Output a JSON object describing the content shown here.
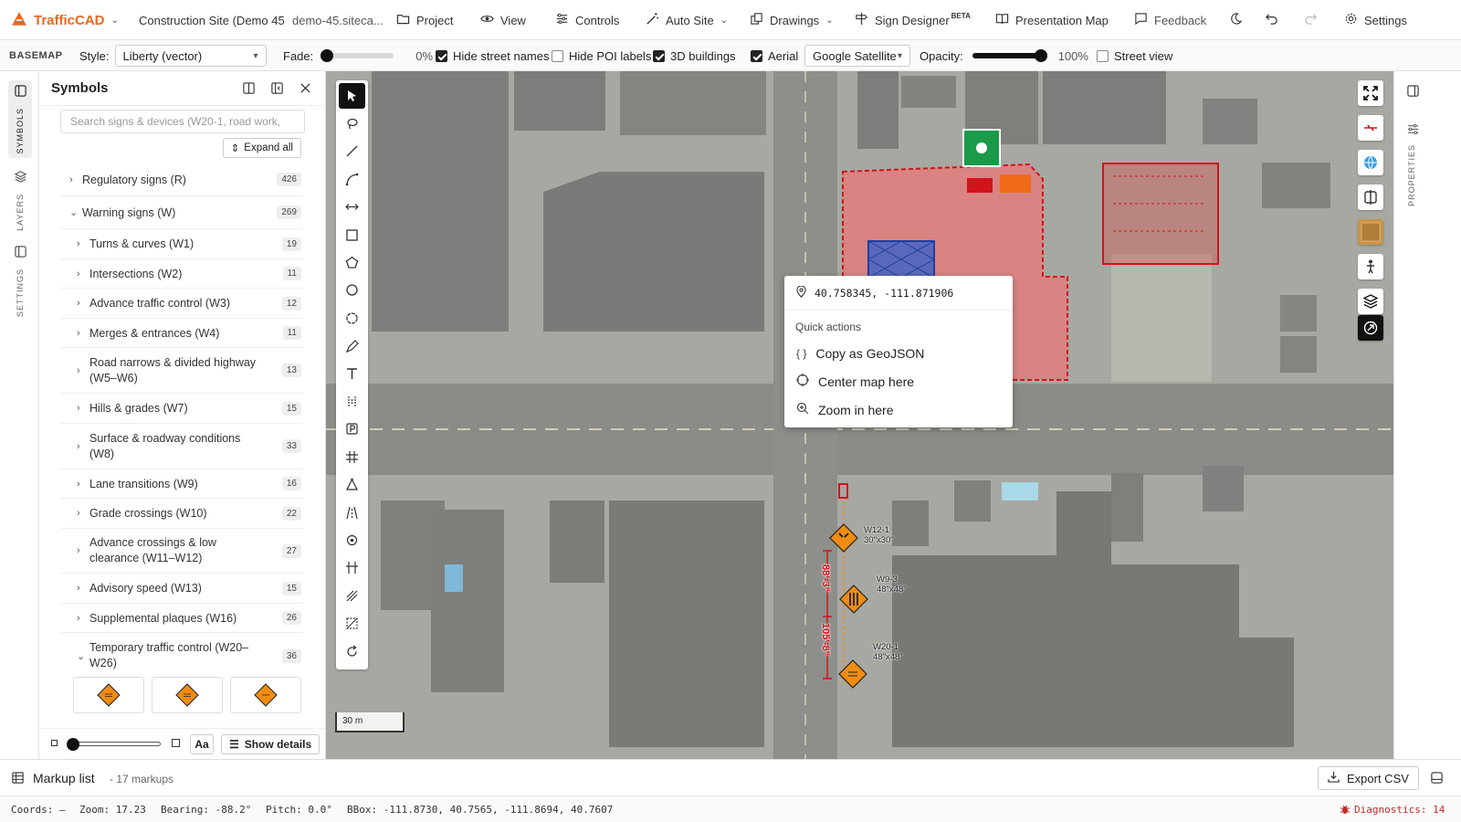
{
  "topbar": {
    "brand": "TrafficCAD",
    "project_name": "Construction Site (Demo 45",
    "project_url": "demo-45.siteca...",
    "project": "Project",
    "view": "View",
    "controls": "Controls",
    "auto_site": "Auto Site",
    "drawings": "Drawings",
    "sign_designer": "Sign Designer",
    "beta": "BETA",
    "presentation_map": "Presentation Map",
    "feedback": "Feedback",
    "settings": "Settings"
  },
  "basemap": {
    "section": "BASEMAP",
    "style_label": "Style:",
    "style_value": "Liberty (vector)",
    "fade_label": "Fade:",
    "fade_value": "0%",
    "fade_level": 0,
    "hide_street_names": "Hide street names",
    "hide_street_names_checked": true,
    "hide_poi_labels": "Hide POI labels",
    "hide_poi_labels_checked": false,
    "buildings_3d": "3D buildings",
    "buildings_3d_checked": true,
    "aerial": "Aerial",
    "aerial_checked": true,
    "aerial_source": "Google Satellite",
    "opacity_label": "Opacity:",
    "opacity_value": "100%",
    "opacity_level": 1,
    "street_view": "Street view",
    "street_view_checked": false
  },
  "rail": {
    "tabs": [
      "SYMBOLS",
      "LAYERS",
      "SETTINGS"
    ]
  },
  "symbols": {
    "title": "Symbols",
    "search_placeholder": "Search signs & devices (W20-1, road work,",
    "expand_all": "Expand all",
    "categories": [
      {
        "label": "Regulatory signs (R)",
        "count": "426",
        "expanded": false,
        "level": 0
      },
      {
        "label": "Warning signs (W)",
        "count": "269",
        "expanded": true,
        "level": 0
      },
      {
        "label": "Turns & curves (W1)",
        "count": "19",
        "level": 1
      },
      {
        "label": "Intersections (W2)",
        "count": "11",
        "level": 1
      },
      {
        "label": "Advance traffic control (W3)",
        "count": "12",
        "level": 1
      },
      {
        "label": "Merges & entrances (W4)",
        "count": "11",
        "level": 1
      },
      {
        "label": "Road narrows & divided highway (W5–W6)",
        "count": "13",
        "level": 1
      },
      {
        "label": "Hills & grades (W7)",
        "count": "15",
        "level": 1
      },
      {
        "label": "Surface & roadway conditions (W8)",
        "count": "33",
        "level": 1
      },
      {
        "label": "Lane transitions (W9)",
        "count": "16",
        "level": 1
      },
      {
        "label": "Grade crossings (W10)",
        "count": "22",
        "level": 1
      },
      {
        "label": "Advance crossings & low clearance (W11–W12)",
        "count": "27",
        "level": 1
      },
      {
        "label": "Advisory speed (W13)",
        "count": "15",
        "level": 1
      },
      {
        "label": "Supplemental plaques (W16)",
        "count": "26",
        "level": 1
      },
      {
        "label": "Temporary traffic control (W20–W26)",
        "count": "36",
        "expanded": true,
        "level": 1
      }
    ],
    "aa": "Aa",
    "show_details": "Show details"
  },
  "map": {
    "context_menu": {
      "coords": "40.758345, -111.871906",
      "heading": "Quick actions",
      "actions": [
        "Copy as GeoJSON",
        "Center map here",
        "Zoom in here"
      ]
    },
    "scale": "30 m",
    "signs": [
      {
        "code": "W12-1",
        "size": "30\"x30\""
      },
      {
        "code": "W9-3",
        "size": "48\"x48\""
      },
      {
        "code": "W20-1",
        "size": "48\"x48\""
      }
    ],
    "dims": [
      "88'-3\"",
      "105'-8\""
    ]
  },
  "properties": {
    "label": "PROPERTIES"
  },
  "markup": {
    "title": "Markup list",
    "count": "- 17 markups",
    "export": "Export CSV"
  },
  "status": {
    "coords": "Coords: –",
    "zoom": "Zoom: 17.23",
    "bearing": "Bearing: -88.2°",
    "pitch": "Pitch: 0.0°",
    "bbox": "BBox: -111.8730, 40.7565, -111.8694, 40.7607",
    "diagnostics": "Diagnostics: 14",
    "diagnostics_color": "#c62828"
  },
  "colors": {
    "brand": "#e8681e",
    "site_fill": "#e8787a",
    "site_stroke": "#d0141a",
    "sign_orange": "#f08c12"
  }
}
